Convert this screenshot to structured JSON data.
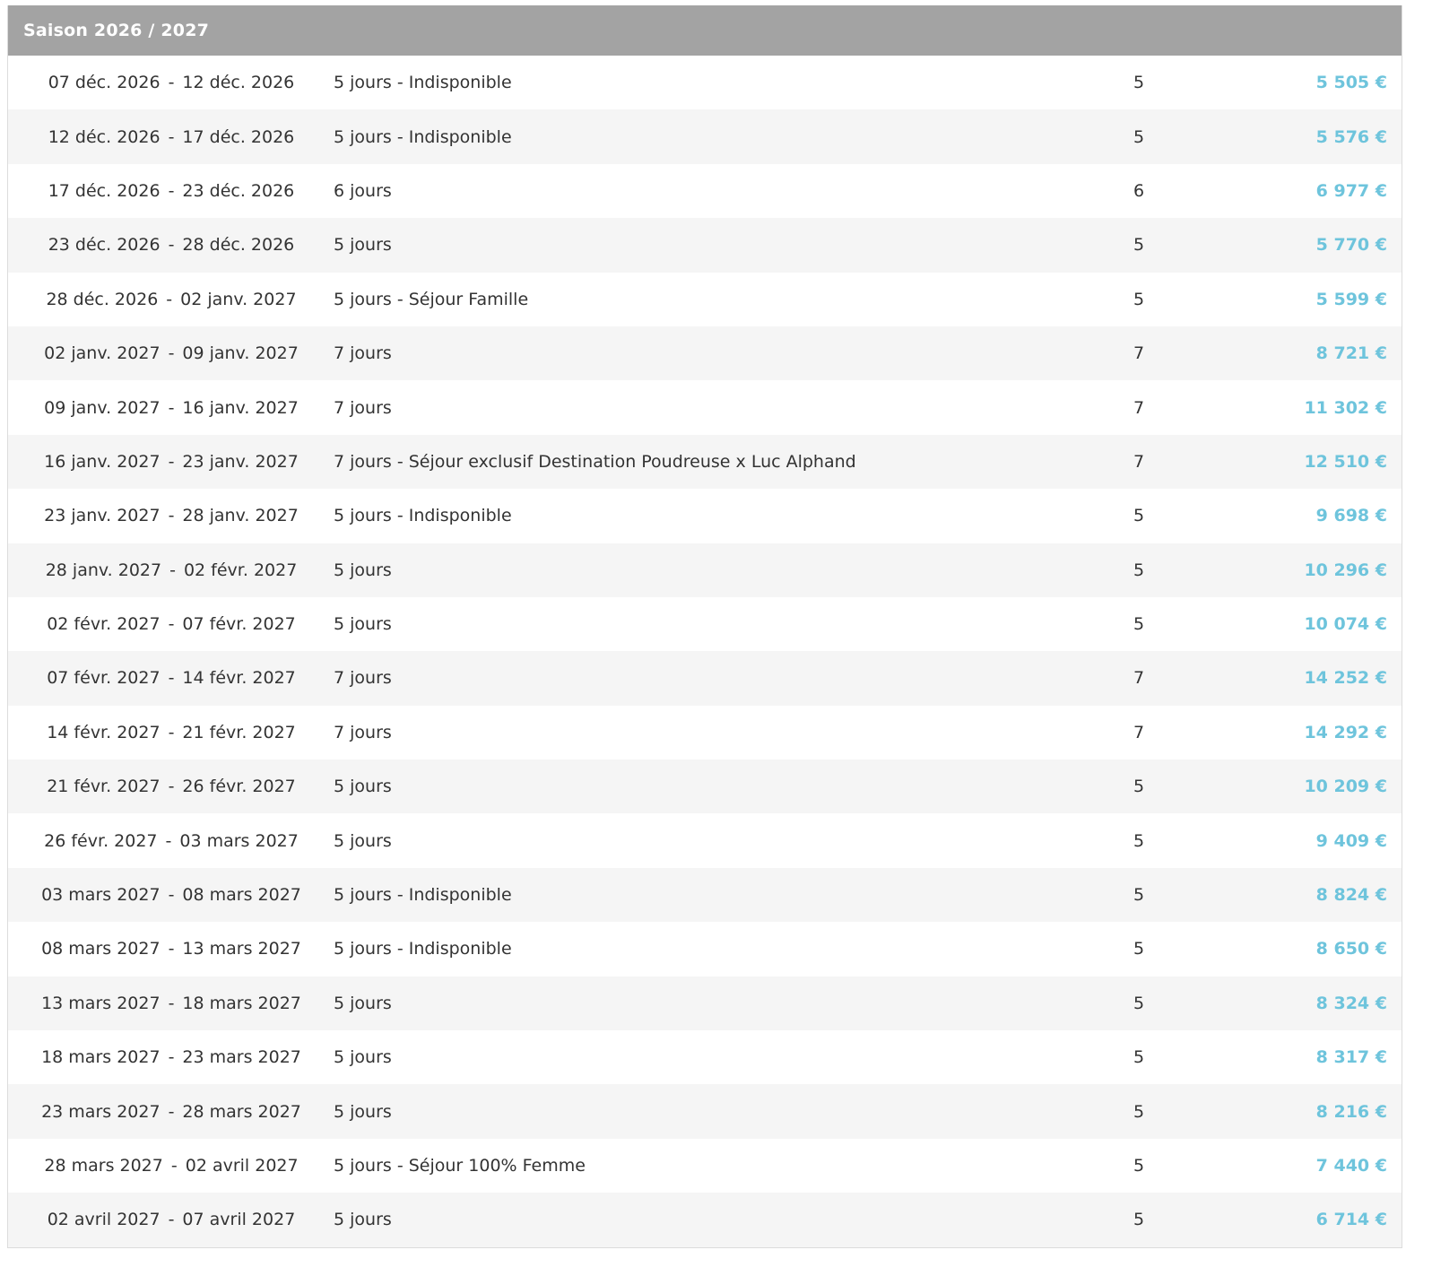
{
  "colors": {
    "header_bg": "#a3a3a3",
    "price": "#6ec4dc",
    "row_alt": "#f5f5f5"
  },
  "season": {
    "title": "Saison 2026 / 2027"
  },
  "date_separator": "-",
  "rows": [
    {
      "start": "07 déc. 2026",
      "end": "12 déc. 2026",
      "label": "5 jours - Indisponible",
      "days": "5",
      "price": "5 505 €"
    },
    {
      "start": "12 déc. 2026",
      "end": "17 déc. 2026",
      "label": "5 jours - Indisponible",
      "days": "5",
      "price": "5 576 €"
    },
    {
      "start": "17 déc. 2026",
      "end": "23 déc. 2026",
      "label": "6 jours",
      "days": "6",
      "price": "6 977 €"
    },
    {
      "start": "23 déc. 2026",
      "end": "28 déc. 2026",
      "label": "5 jours",
      "days": "5",
      "price": "5 770 €"
    },
    {
      "start": "28 déc. 2026",
      "end": "02 janv. 2027",
      "label": "5 jours - Séjour Famille",
      "days": "5",
      "price": "5 599 €"
    },
    {
      "start": "02 janv. 2027",
      "end": "09 janv. 2027",
      "label": "7 jours",
      "days": "7",
      "price": "8 721 €"
    },
    {
      "start": "09 janv. 2027",
      "end": "16 janv. 2027",
      "label": "7 jours",
      "days": "7",
      "price": "11 302 €"
    },
    {
      "start": "16 janv. 2027",
      "end": "23 janv. 2027",
      "label": "7 jours - Séjour exclusif Destination Poudreuse x Luc Alphand",
      "days": "7",
      "price": "12 510 €"
    },
    {
      "start": "23 janv. 2027",
      "end": "28 janv. 2027",
      "label": "5 jours - Indisponible",
      "days": "5",
      "price": "9 698 €"
    },
    {
      "start": "28 janv. 2027",
      "end": "02 févr. 2027",
      "label": "5 jours",
      "days": "5",
      "price": "10 296 €"
    },
    {
      "start": "02 févr. 2027",
      "end": "07 févr. 2027",
      "label": "5 jours",
      "days": "5",
      "price": "10 074 €"
    },
    {
      "start": "07 févr. 2027",
      "end": "14 févr. 2027",
      "label": "7 jours",
      "days": "7",
      "price": "14 252 €"
    },
    {
      "start": "14 févr. 2027",
      "end": "21 févr. 2027",
      "label": "7 jours",
      "days": "7",
      "price": "14 292 €"
    },
    {
      "start": "21 févr. 2027",
      "end": "26 févr. 2027",
      "label": "5 jours",
      "days": "5",
      "price": "10 209 €"
    },
    {
      "start": "26 févr. 2027",
      "end": "03 mars 2027",
      "label": "5 jours",
      "days": "5",
      "price": "9 409 €"
    },
    {
      "start": "03 mars 2027",
      "end": "08 mars 2027",
      "label": "5 jours - Indisponible",
      "days": "5",
      "price": "8 824 €"
    },
    {
      "start": "08 mars 2027",
      "end": "13 mars 2027",
      "label": "5 jours - Indisponible",
      "days": "5",
      "price": "8 650 €"
    },
    {
      "start": "13 mars 2027",
      "end": "18 mars 2027",
      "label": "5 jours",
      "days": "5",
      "price": "8 324 €"
    },
    {
      "start": "18 mars 2027",
      "end": "23 mars 2027",
      "label": "5 jours",
      "days": "5",
      "price": "8 317 €"
    },
    {
      "start": "23 mars 2027",
      "end": "28 mars 2027",
      "label": "5 jours",
      "days": "5",
      "price": "8 216 €"
    },
    {
      "start": "28 mars 2027",
      "end": "02 avril 2027",
      "label": "5 jours - Séjour 100% Femme",
      "days": "5",
      "price": "7 440 €"
    },
    {
      "start": "02 avril 2027",
      "end": "07 avril 2027",
      "label": "5 jours",
      "days": "5",
      "price": "6 714 €"
    }
  ]
}
